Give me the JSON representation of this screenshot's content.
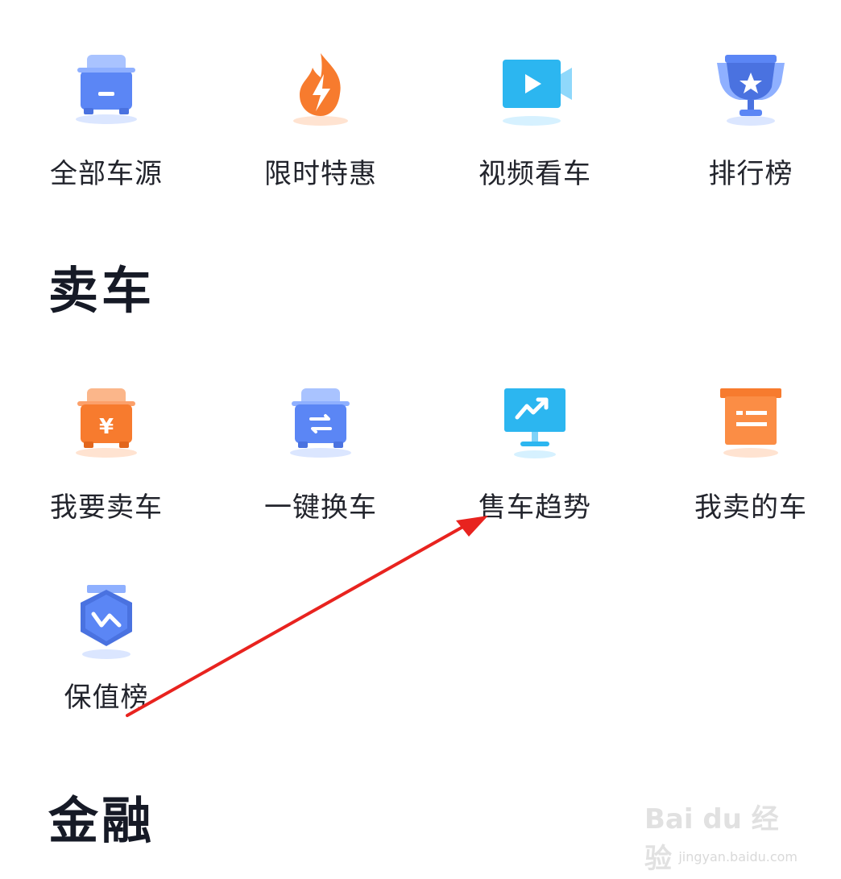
{
  "buy_section": {
    "items": [
      {
        "label": "全部车源",
        "icon": "car-icon"
      },
      {
        "label": "限时特惠",
        "icon": "flame-lightning-icon"
      },
      {
        "label": "视频看车",
        "icon": "video-camera-icon"
      },
      {
        "label": "排行榜",
        "icon": "trophy-icon"
      }
    ]
  },
  "sell_section": {
    "title": "卖车",
    "items": [
      {
        "label": "我要卖车",
        "icon": "car-yuan-icon"
      },
      {
        "label": "一键换车",
        "icon": "car-swap-icon"
      },
      {
        "label": "售车趋势",
        "icon": "trend-monitor-icon"
      },
      {
        "label": "我卖的车",
        "icon": "box-list-icon"
      },
      {
        "label": "保值榜",
        "icon": "value-badge-icon"
      }
    ]
  },
  "finance_section": {
    "title": "金融"
  },
  "colors": {
    "blue": "#5b86f5",
    "orange": "#f77b2e",
    "cyan": "#2cb6f0",
    "arrow_red": "#e8231f"
  },
  "watermark": {
    "logo": "Bai du 经验",
    "url": "jingyan.baidu.com"
  }
}
